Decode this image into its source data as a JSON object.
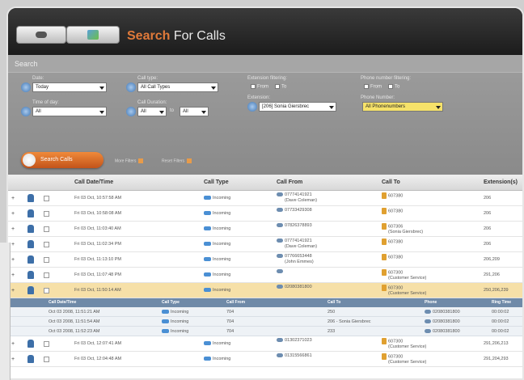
{
  "toolbar": {
    "app_word1": "Search",
    "app_word2": "For Calls"
  },
  "search": {
    "header": "Search",
    "date_label": "Date:",
    "date_value": "Today",
    "time_label": "Time of day:",
    "time_value": "All",
    "calltype_label": "Call type:",
    "calltype_value": "All Call Types",
    "duration_label": "Call Duration:",
    "duration_from": "All",
    "duration_to_word": "to",
    "duration_to": "All",
    "ext_filter_label": "Extension filtering:",
    "ext_from": "From",
    "ext_to": "To",
    "extension_label": "Extension:",
    "extension_value": "[206] Sonia Giersbrec",
    "phone_filter_label": "Phone number filtering:",
    "phone_from": "From",
    "phone_to": "To",
    "phone_label": "Phone Number:",
    "phone_value": "All Phonenumbers",
    "button_label": "Search Calls",
    "opt1": "More Filters",
    "opt2": "Reset Filters"
  },
  "grid": {
    "columns": [
      "Call Date/Time",
      "Call Type",
      "Call From",
      "Call To",
      "Extension(s)"
    ],
    "rows": [
      {
        "date": "Fri 03 Oct, 10:57:58 AM",
        "type": "Incoming",
        "from1": "07774141921",
        "from2": "(Dave Coleman)",
        "to1": "607380",
        "to2": "",
        "ext": "206"
      },
      {
        "date": "Fri 03 Oct, 10:58:08 AM",
        "type": "Incoming",
        "from1": "07733429308",
        "from2": "",
        "to1": "607380",
        "to2": "",
        "ext": "206"
      },
      {
        "date": "Fri 03 Oct, 11:03:40 AM",
        "type": "Incoming",
        "from1": "07826378893",
        "from2": "",
        "to1": "607306",
        "to2": "(Sonia Giersbrec)",
        "ext": "206"
      },
      {
        "date": "Fri 03 Oct, 11:02:34 PM",
        "type": "Incoming",
        "from1": "07774141921",
        "from2": "(Dave Coleman)",
        "to1": "607380",
        "to2": "",
        "ext": "206"
      },
      {
        "date": "Fri 03 Oct, 11:13:10 PM",
        "type": "Incoming",
        "from1": "07766653448",
        "from2": "(John Emmes)",
        "to1": "607380",
        "to2": "",
        "ext": "206,209"
      },
      {
        "date": "Fri 03 Oct, 11:07:48 PM",
        "type": "Incoming",
        "from1": "",
        "from2": "",
        "to1": "607300",
        "to2": "(Customer Service)",
        "ext": "291,206"
      },
      {
        "date": "Fri 03 Oct, 11:50:14 AM",
        "type": "Incoming",
        "from1": "02080381800",
        "from2": "",
        "to1": "607300",
        "to2": "(Customer Service)",
        "ext": "250,206,239"
      }
    ],
    "sub": {
      "columns": [
        "Call Date/Time",
        "Call Type",
        "Call From",
        "Call To",
        "Phone",
        "Ring Time"
      ],
      "rows": [
        {
          "date": "Oct 03 2008, 11:51:21 AM",
          "type": "Incoming",
          "from": "704",
          "to1": "250",
          "to2": "",
          "phone": "02080381800",
          "ring": "00:00:02"
        },
        {
          "date": "Oct 03 2008, 11:51:54 AM",
          "type": "Incoming",
          "from": "704",
          "to1": "206 - Sonia Giersbrec",
          "to2": "",
          "phone": "02080381800",
          "ring": "00:00:02"
        },
        {
          "date": "Oct 03 2008, 11:52:23 AM",
          "type": "Incoming",
          "from": "704",
          "to1": "233",
          "to2": "",
          "phone": "02080381800",
          "ring": "00:00:02"
        }
      ]
    },
    "more_rows": [
      {
        "date": "Fri 03 Oct, 12:07:41 AM",
        "type": "Incoming",
        "from1": "01302371023",
        "to1": "607300",
        "to2": "(Customer Service)",
        "ext": "291,206,213"
      },
      {
        "date": "Fri 03 Oct, 12:04:48 AM",
        "type": "Incoming",
        "from1": "01315566861",
        "to1": "607300",
        "to2": "(Customer Service)",
        "ext": "291,204,293"
      }
    ]
  }
}
